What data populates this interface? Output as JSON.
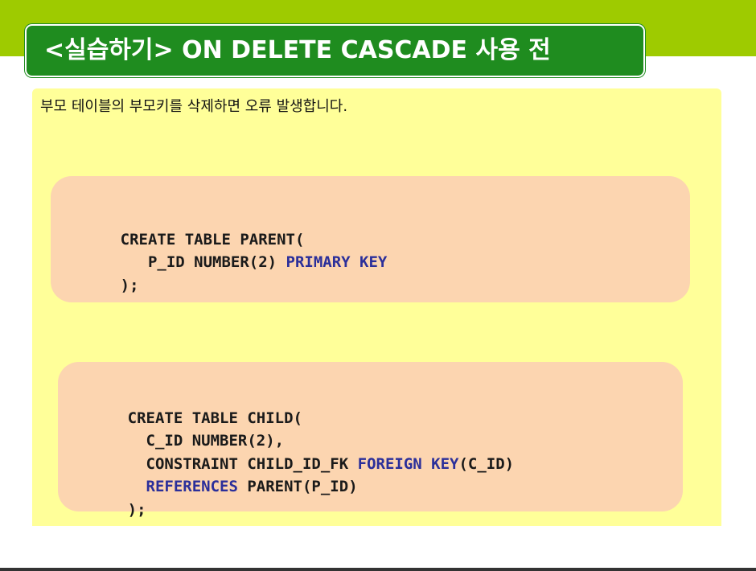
{
  "title": "<실습하기> ON DELETE CASCADE 사용 전",
  "intro": "부모 테이블의 부모키를 삭제하면 오류 발생합니다.",
  "parent_code": [
    {
      "segments": [
        {
          "text": "CREATE TABLE PARENT(",
          "keyword": false
        }
      ]
    },
    {
      "segments": [
        {
          "text": "   P_ID NUMBER(2) ",
          "keyword": false
        },
        {
          "text": "PRIMARY KEY",
          "keyword": true
        }
      ]
    },
    {
      "segments": [
        {
          "text": ");",
          "keyword": false
        }
      ]
    }
  ],
  "child_code": [
    {
      "segments": [
        {
          "text": "CREATE TABLE CHILD(",
          "keyword": false
        }
      ]
    },
    {
      "segments": [
        {
          "text": "  C_ID NUMBER(2),",
          "keyword": false
        }
      ]
    },
    {
      "segments": [
        {
          "text": "  CONSTRAINT CHILD_ID_FK ",
          "keyword": false
        },
        {
          "text": "FOREIGN KEY",
          "keyword": true
        },
        {
          "text": "(C_ID)",
          "keyword": false
        }
      ]
    },
    {
      "segments": [
        {
          "text": "  ",
          "keyword": false
        },
        {
          "text": "REFERENCES",
          "keyword": true
        },
        {
          "text": " PARENT(P_ID)",
          "keyword": false
        }
      ]
    },
    {
      "segments": [
        {
          "text": ");",
          "keyword": false
        }
      ]
    }
  ],
  "colors": {
    "top_band": "#9ecb00",
    "title_bg": "#1f8c1f",
    "panel_bg": "#ffff99",
    "code_bg": "#fcd5b0",
    "keyword": "#2b2f9a"
  }
}
